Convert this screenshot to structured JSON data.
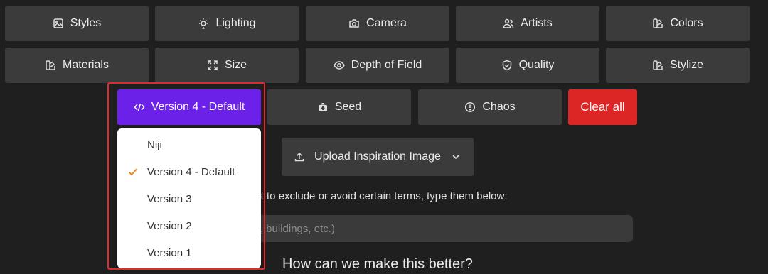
{
  "row1": [
    {
      "label": "Styles",
      "icon": "image-icon"
    },
    {
      "label": "Lighting",
      "icon": "lightbulb-icon"
    },
    {
      "label": "Camera",
      "icon": "camera-icon"
    },
    {
      "label": "Artists",
      "icon": "users-icon"
    },
    {
      "label": "Colors",
      "icon": "palette-icon"
    }
  ],
  "row2": [
    {
      "label": "Materials",
      "icon": "palette-icon"
    },
    {
      "label": "Size",
      "icon": "expand-icon"
    },
    {
      "label": "Depth of Field",
      "icon": "eye-icon"
    },
    {
      "label": "Quality",
      "icon": "shield-check-icon"
    },
    {
      "label": "Stylize",
      "icon": "palette-icon"
    }
  ],
  "row3": {
    "version_label": "Version 4 - Default",
    "seed_label": "Seed",
    "chaos_label": "Chaos",
    "clear_label": "Clear all"
  },
  "upload": {
    "label": "Upload Inspiration Image"
  },
  "exclude": {
    "prompt": "ant to exclude or avoid certain terms, type them below:",
    "placeholder": "es, buildings, etc.)"
  },
  "feedback": {
    "heading": "How can we make this better?"
  },
  "version_dropdown": {
    "items": [
      {
        "label": "Niji",
        "selected": false
      },
      {
        "label": "Version 4 - Default",
        "selected": true
      },
      {
        "label": "Version 3",
        "selected": false
      },
      {
        "label": "Version 2",
        "selected": false
      },
      {
        "label": "Version 1",
        "selected": false
      }
    ]
  },
  "colors": {
    "accent": "#6b21e8",
    "danger": "#dc2626",
    "check": "#e8891c",
    "highlight": "#e12a2a"
  }
}
